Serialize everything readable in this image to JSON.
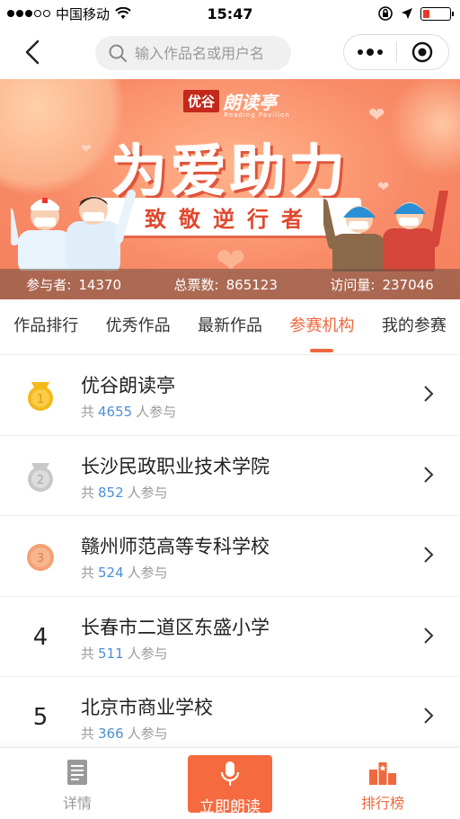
{
  "status_bar": {
    "carrier": "中国移动",
    "time": "15:47"
  },
  "nav": {
    "search_placeholder": "输入作品名或用户名"
  },
  "banner": {
    "brand_tag": "优谷",
    "brand_name": "朗读亭",
    "brand_sub": "Reading Pavilion",
    "headline": "为爱助力",
    "ribbon": "致敬逆行者",
    "stats": [
      {
        "label": "参与者:",
        "value": "14370"
      },
      {
        "label": "总票数:",
        "value": "865123"
      },
      {
        "label": "访问量:",
        "value": "237046"
      }
    ]
  },
  "tabs": [
    {
      "label": "作品排行",
      "active": false
    },
    {
      "label": "优秀作品",
      "active": false
    },
    {
      "label": "最新作品",
      "active": false
    },
    {
      "label": "参赛机构",
      "active": true
    },
    {
      "label": "我的参赛",
      "active": false
    }
  ],
  "organizations": [
    {
      "rank": "1",
      "medal": "gold",
      "name": "优谷朗读亭",
      "prefix": "共",
      "count": "4655",
      "suffix": "人参与"
    },
    {
      "rank": "2",
      "medal": "silver",
      "name": "长沙民政职业技术学院",
      "prefix": "共",
      "count": "852",
      "suffix": "人参与"
    },
    {
      "rank": "3",
      "medal": "bronze",
      "name": "赣州师范高等专科学校",
      "prefix": "共",
      "count": "524",
      "suffix": "人参与"
    },
    {
      "rank": "4",
      "medal": "",
      "name": "长春市二道区东盛小学",
      "prefix": "共",
      "count": "511",
      "suffix": "人参与"
    },
    {
      "rank": "5",
      "medal": "",
      "name": "北京市商业学校",
      "prefix": "共",
      "count": "366",
      "suffix": "人参与"
    }
  ],
  "bottom_bar": {
    "details": "详情",
    "record": "立即朗读",
    "ranking": "排行榜"
  },
  "colors": {
    "accent": "#f0683e",
    "count_blue": "#4b8fd6",
    "gold": "#f5b81a",
    "silver": "#c8c8c8",
    "bronze": "#f3a173"
  }
}
